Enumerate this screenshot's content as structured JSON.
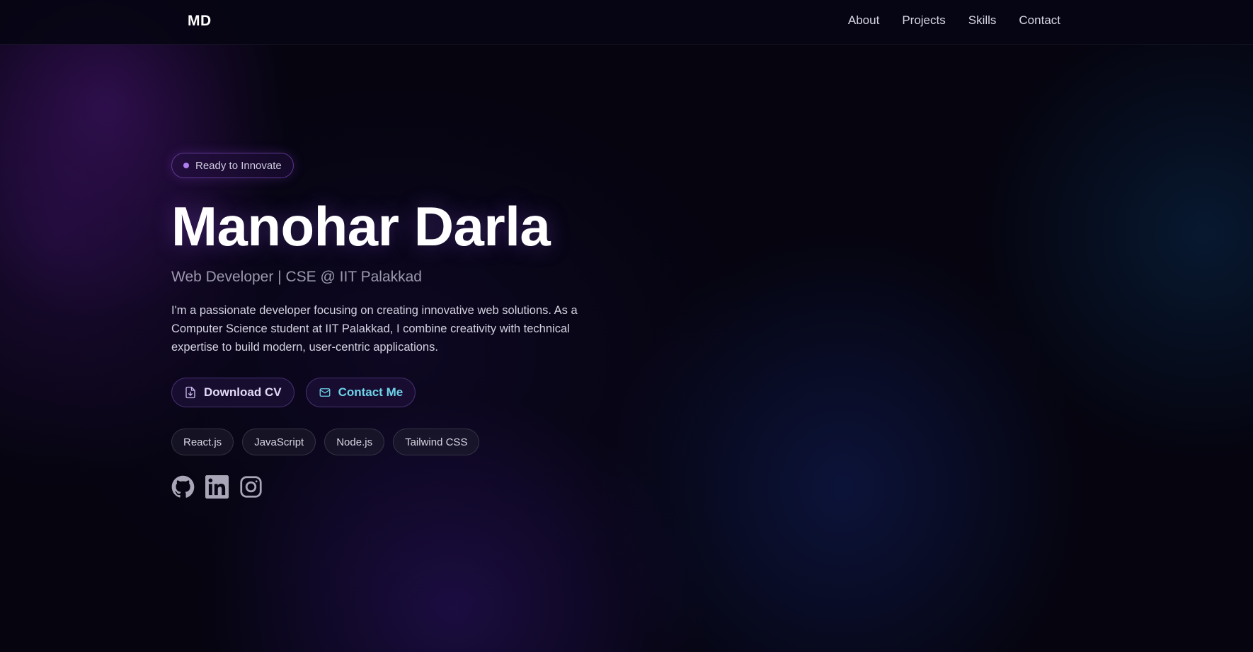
{
  "nav": {
    "logo": "MD",
    "links": [
      {
        "label": "About"
      },
      {
        "label": "Projects"
      },
      {
        "label": "Skills"
      },
      {
        "label": "Contact"
      }
    ]
  },
  "hero": {
    "badge": "Ready to Innovate",
    "name": "Manohar Darla",
    "subtitle": "Web Developer | CSE @ IIT Palakkad",
    "bio": "I'm a passionate developer focusing on creating innovative web solutions. As a Computer Science student at IIT Palakkad, I combine creativity with technical expertise to build modern, user-centric applications.",
    "buttons": {
      "download_cv": {
        "label": "Download CV",
        "icon": "file-download-icon"
      },
      "contact_me": {
        "label": "Contact Me",
        "icon": "mail-icon"
      }
    },
    "tags": [
      "React.js",
      "JavaScript",
      "Node.js",
      "Tailwind CSS"
    ],
    "socials": [
      {
        "icon": "github-icon"
      },
      {
        "icon": "linkedin-icon"
      },
      {
        "icon": "instagram-icon"
      }
    ]
  },
  "colors": {
    "background": "#05040f",
    "accent_purple": "#b07ef0",
    "accent_cyan": "#6ed3ea",
    "text_primary": "#ffffff",
    "text_muted": "#9b98ad"
  }
}
